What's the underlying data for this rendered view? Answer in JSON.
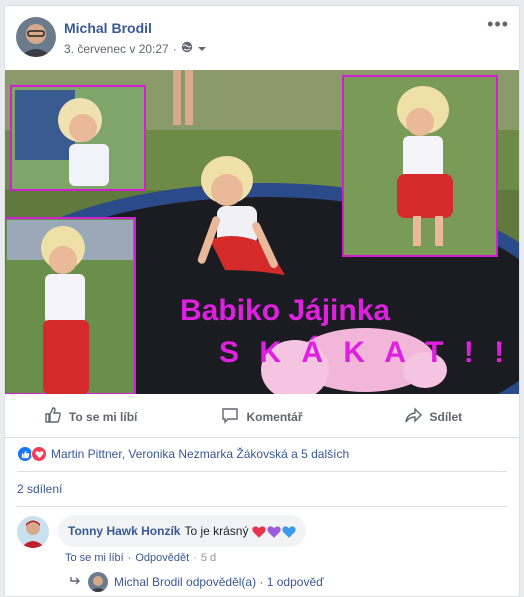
{
  "post": {
    "author": "Michal Brodil",
    "date": "3. červenec v 20:27",
    "separator": "·",
    "more": "•••"
  },
  "image": {
    "overlay_line1": "Babiko Jájinka",
    "overlay_line2": "S K Á K A T  ! !"
  },
  "actions": {
    "like": "To se mi líbí",
    "comment": "Komentář",
    "share": "Sdílet"
  },
  "reactions": {
    "text": "Martin Pittner, Veronika Nezmarka Žákovská a 5 dalších"
  },
  "shares": "2 sdílení",
  "comment": {
    "author": "Tonny Hawk Honzík",
    "text": "To je krásný",
    "like": "To se mi líbí",
    "sep": "·",
    "reply": "Odpovědět",
    "time": "5 d"
  },
  "reply_summary": {
    "text": "Michal Brodil odpověděl(a) · 1 odpověď"
  },
  "colors": {
    "link": "#385898",
    "like_blue": "#1877f2",
    "love_red": "#f33e58",
    "overlay_magenta": "#e020e0"
  }
}
